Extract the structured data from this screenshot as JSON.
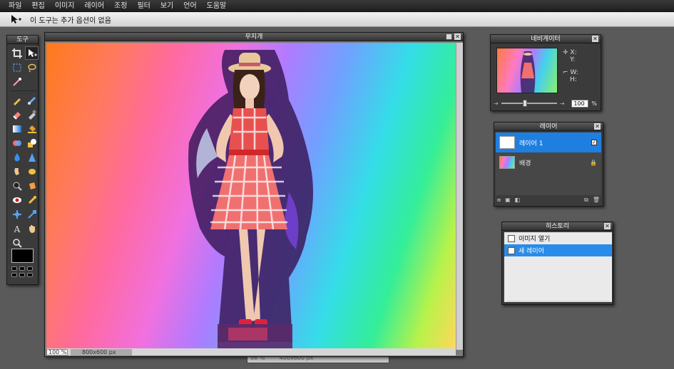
{
  "menu": {
    "items": [
      "파일",
      "편집",
      "이미지",
      "레이어",
      "조정",
      "필터",
      "보기",
      "언어",
      "도움말"
    ]
  },
  "options_bar": {
    "message": "이 도구는 추가 옵션이 없음"
  },
  "tools": {
    "title": "도구",
    "items": [
      "crop-icon",
      "move-icon",
      "marquee-icon",
      "lasso-icon",
      "wand-icon",
      "pencil-icon",
      "brush-icon",
      "eraser-icon",
      "clone-icon",
      "gradient-icon",
      "bucket-icon",
      "replace-color-icon",
      "shape-icon",
      "drop-icon",
      "sharpen-icon",
      "smudge-icon",
      "dodge-icon",
      "burn-icon",
      "sponge-icon",
      "redeye-icon",
      "bloat-icon",
      "pinch-icon",
      "eyedropper-icon",
      "type-icon",
      "hand-icon",
      "zoom-icon"
    ]
  },
  "document": {
    "title": "무지개",
    "zoom": "100 %",
    "size": "800x600 px"
  },
  "back_document": {
    "zoom": "98 %",
    "size": "400x600 px"
  },
  "navigator": {
    "title": "네비게이터",
    "x_label": "X:",
    "y_label": "Y:",
    "w_label": "W:",
    "h_label": "H:",
    "zoom_value": "100",
    "zoom_unit": "%"
  },
  "layers": {
    "title": "레이어",
    "items": [
      {
        "name": "레이어 1",
        "selected": true
      },
      {
        "name": "배경",
        "selected": false
      }
    ]
  },
  "history": {
    "title": "히스토리",
    "items": [
      {
        "label": "이미지 열기",
        "selected": false
      },
      {
        "label": "새 레이어",
        "selected": true
      }
    ]
  }
}
